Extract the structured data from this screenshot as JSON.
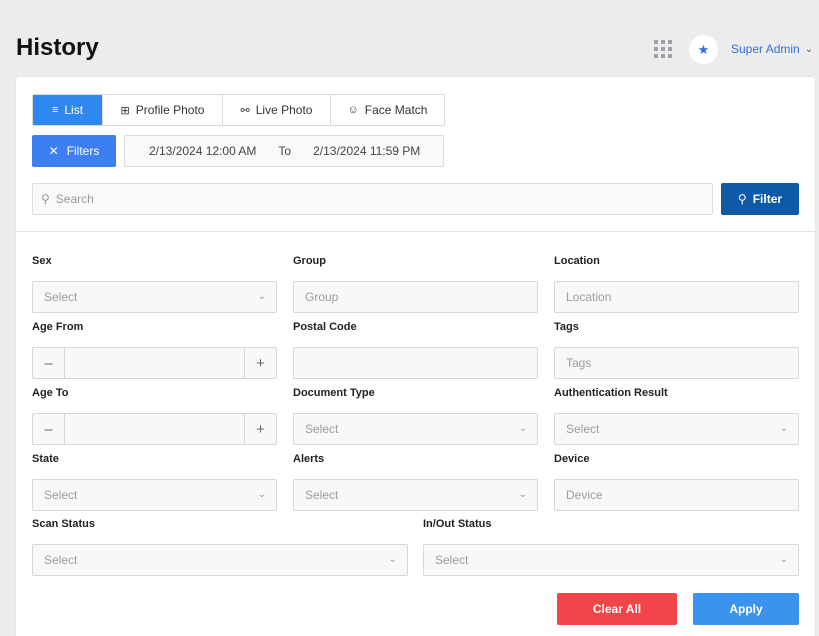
{
  "header": {
    "title": "History",
    "user_name": "Super Admin"
  },
  "tabs": [
    {
      "label": "List",
      "icon": "list-icon"
    },
    {
      "label": "Profile Photo",
      "icon": "grid-squares-icon"
    },
    {
      "label": "Live Photo",
      "icon": "users-icon"
    },
    {
      "label": "Face Match",
      "icon": "user-icon"
    }
  ],
  "toolbar": {
    "filters_label": "Filters",
    "date_from": "2/13/2024 12:00 AM",
    "date_sep": "To",
    "date_to": "2/13/2024 11:59 PM",
    "search_placeholder": "Search",
    "filter_label": "Filter"
  },
  "form": {
    "sex": {
      "label": "Sex",
      "placeholder": "Select"
    },
    "group": {
      "label": "Group",
      "placeholder": "Group"
    },
    "location": {
      "label": "Location",
      "placeholder": "Location"
    },
    "age_from": {
      "label": "Age From"
    },
    "postal_code": {
      "label": "Postal Code",
      "placeholder": ""
    },
    "tags": {
      "label": "Tags",
      "placeholder": "Tags"
    },
    "age_to": {
      "label": "Age To"
    },
    "document_type": {
      "label": "Document Type",
      "placeholder": "Select"
    },
    "auth_result": {
      "label": "Authentication Result",
      "placeholder": "Select"
    },
    "state": {
      "label": "State",
      "placeholder": "Select"
    },
    "alerts": {
      "label": "Alerts",
      "placeholder": "Select"
    },
    "device": {
      "label": "Device",
      "placeholder": "Device"
    },
    "scan_status": {
      "label": "Scan Status",
      "placeholder": "Select"
    },
    "inout_status": {
      "label": "In/Out Status",
      "placeholder": "Select"
    }
  },
  "actions": {
    "clear_label": "Clear All",
    "apply_label": "Apply"
  },
  "colors": {
    "accent": "#2f88f0",
    "filter_button": "#0e5aa7",
    "clear_button": "#f2454a",
    "apply_button": "#3a93ec"
  }
}
